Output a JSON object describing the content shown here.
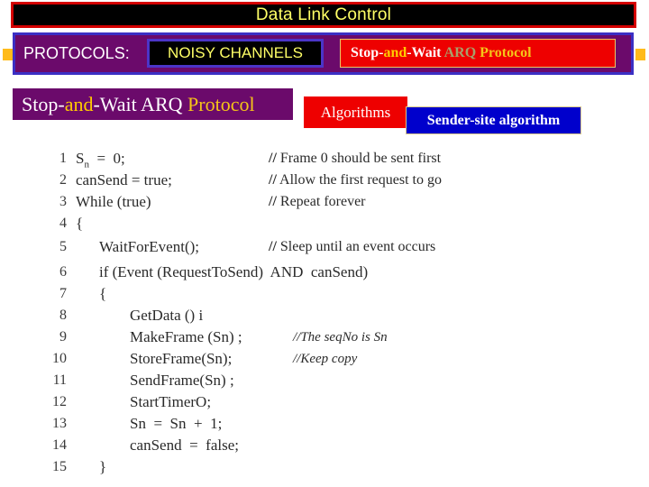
{
  "slide": {
    "title": "Data Link Control",
    "title_colors": {
      "background": "#000000",
      "border": "#d40000",
      "text": "#ffff66"
    }
  },
  "protocol_band": {
    "background": "#6b0a6b",
    "border": "#3b2fc4",
    "protocols_label": "PROTOCOLS:",
    "noisy_channels": {
      "label": "NOISY CHANNELS",
      "background": "#000000",
      "border": "#4b35c8",
      "text_color": "#ffff66"
    },
    "current_protocol": {
      "parts": [
        {
          "text": "Stop-",
          "color": "#ffffff"
        },
        {
          "text": "and",
          "color": "#ffcc00"
        },
        {
          "text": "-Wait ",
          "color": "#ffffff"
        },
        {
          "text": "ARQ ",
          "color": "#a8a06a"
        },
        {
          "text": "Protocol",
          "color": "#f5c518"
        }
      ],
      "plain": "Stop-and-Wait ARQ Protocol",
      "background": "#ee0000",
      "border": "#e8c86a"
    },
    "marker_color": "#ffbb1a"
  },
  "heading": {
    "parts": [
      {
        "text": "Stop-",
        "color": "#ffffff"
      },
      {
        "text": "and",
        "color": "#ffcc00"
      },
      {
        "text": "-Wait ARQ ",
        "color": "#ffffff"
      },
      {
        "text": "Protocol",
        "color": "#f5c518"
      }
    ],
    "plain": "Stop-and-Wait ARQ Protocol",
    "background": "#6b0a6b"
  },
  "algorithms": {
    "label": "Algorithms",
    "background": "#ee0000",
    "text_color": "#ffffff"
  },
  "sender_site": {
    "label": "Sender-site algorithm",
    "background": "#0000cc",
    "border": "#d8c88a",
    "text_color": "#ffffff"
  },
  "code": {
    "lines": [
      {
        "n": "1",
        "indent": 0,
        "code": "S",
        "sub": "n",
        "code_after": "  =  0;",
        "comment": "// Frame 0 should be sent first"
      },
      {
        "n": "2",
        "indent": 0,
        "code": "canSend = true;",
        "comment": "// Allow the first request to go"
      },
      {
        "n": "3",
        "indent": 0,
        "code": "While (true)",
        "comment": "// Repeat forever"
      },
      {
        "n": "4",
        "indent": 0,
        "code": "{",
        "comment": ""
      },
      {
        "n": "5",
        "indent": 1,
        "code": "WaitForEvent();",
        "comment": "// Sleep until an event occurs"
      },
      {
        "n": "6",
        "indent": 1,
        "code": "if (Event (RequestToSend)  AND  canSend)",
        "comment": ""
      },
      {
        "n": "7",
        "indent": 1,
        "code": "{",
        "comment": ""
      },
      {
        "n": "8",
        "indent": 2,
        "code": "GetData () i",
        "comment": ""
      },
      {
        "n": "9",
        "indent": 2,
        "code": "MakeFrame (Sn) ;",
        "inline_comment": "//The seqNo is Sn"
      },
      {
        "n": "10",
        "indent": 2,
        "code": "StoreFrame(Sn);",
        "inline_comment": "//Keep copy"
      },
      {
        "n": "11",
        "indent": 2,
        "code": "SendFrame(Sn) ;",
        "comment": ""
      },
      {
        "n": "12",
        "indent": 2,
        "code": "StartTimerO;",
        "comment": ""
      },
      {
        "n": "13",
        "indent": 2,
        "code": "Sn  =  Sn  +  1;",
        "comment": ""
      },
      {
        "n": "14",
        "indent": 2,
        "code": "canSend  =  false;",
        "comment": ""
      },
      {
        "n": "15",
        "indent": 1,
        "code": "}",
        "comment": ""
      }
    ]
  }
}
